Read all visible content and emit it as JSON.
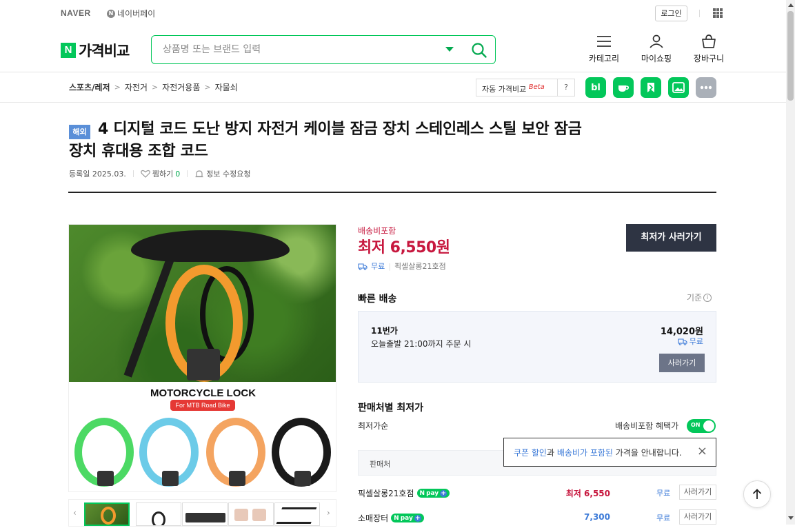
{
  "topbar": {
    "naver_label": "NAVER",
    "npay_label": "네이버페이",
    "login_label": "로그인"
  },
  "header": {
    "brand_n": "N",
    "brand_label": "가격비교",
    "search_placeholder": "상품명 또는 브랜드 입력",
    "category_label": "카테고리",
    "myshopping_label": "마이쇼핑",
    "cart_label": "장바구니"
  },
  "breadcrumb": [
    "스포츠/레저",
    "자전거",
    "자전거용품",
    "자물쇠"
  ],
  "breadcrumb_sep": ">",
  "tools": {
    "auto_compare_label": "자동 가격비교",
    "beta_label": "Beta",
    "help_label": "?",
    "shortcut_bl": "bl",
    "accent_color": "#03c75a"
  },
  "product": {
    "overseas_badge": "해외",
    "title": "4 디지털 코드 도난 방지 자전거 케이블 잠금 장치 스테인레스 스틸 보안 잠금 장치 휴대용 조합 코드",
    "registered": "등록일 2025.03.",
    "zzim_label": "찜하기",
    "zzim_count": "0",
    "report_label": "정보 수정요청",
    "image_heading": "MOTORCYCLE LOCK",
    "image_pill": "For MTB Road Bike"
  },
  "price": {
    "shipping_included": "배송비포함",
    "lowest_label": "최저 6,550원",
    "free_shipping": "무료",
    "seller": "픽셀살롱21호점",
    "buy_lowest_button": "최저가 사러가기",
    "lowest_color": "#c7173e"
  },
  "fast_delivery": {
    "title": "빠른 배송",
    "basis_label": "기준",
    "seller": "11번가",
    "desc": "오늘출발 21:00까지 주문 시",
    "price": "14,020원",
    "shipping": "무료",
    "buy_button": "사러가기"
  },
  "sellers": {
    "title": "판매처별 최저가",
    "sort_label": "최저가순",
    "toggle_label": "배송비포함 혜택가",
    "toggle_state": "ON",
    "column_seller": "판매처",
    "tooltip_hl1": "쿠폰 할인",
    "tooltip_mid": "과 ",
    "tooltip_hl2": "배송비가 포함된",
    "tooltip_rest": " 가격을 안내합니다.",
    "tooltip_close": "×",
    "rows": [
      {
        "name": "픽셀살롱21호점",
        "npay": "pay",
        "price": "최저 6,550",
        "shipping": "무료",
        "buy": "사러가기"
      },
      {
        "name": "소매장터",
        "npay": "pay",
        "price": "7,300",
        "shipping": "무료",
        "buy": "사러가기"
      }
    ]
  },
  "icons": {
    "npay_n": "N",
    "plus": "+"
  }
}
